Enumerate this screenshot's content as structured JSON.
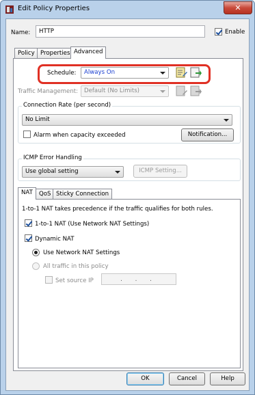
{
  "window": {
    "title": "Edit Policy Properties",
    "close_glyph": "✕"
  },
  "name_row": {
    "label": "Name:",
    "value": "HTTP",
    "enable_label": "Enable",
    "enable_checked": true
  },
  "tabs": [
    {
      "label": "Policy"
    },
    {
      "label": "Properties"
    },
    {
      "label": "Advanced",
      "active": true
    }
  ],
  "advanced": {
    "schedule": {
      "label": "Schedule:",
      "value": "Always On"
    },
    "traffic_management": {
      "label": "Traffic Management:",
      "value": "Default (No Limits)"
    },
    "connection_rate": {
      "title": "Connection Rate (per second)",
      "value": "No Limit",
      "alarm_label": "Alarm when capacity exceeded",
      "alarm_checked": false,
      "notification_button": "Notification..."
    },
    "icmp": {
      "title": "ICMP Error Handling",
      "value": "Use global setting",
      "settings_button": "ICMP Setting..."
    }
  },
  "subtabs": [
    {
      "label": "NAT",
      "active": true
    },
    {
      "label": "QoS"
    },
    {
      "label": "Sticky Connection"
    }
  ],
  "nat": {
    "info": "1-to-1 NAT takes precedence if the traffic qualifies for both rules.",
    "one_to_one_label": "1-to-1 NAT (Use Network NAT Settings)",
    "one_to_one_checked": true,
    "dynamic_label": "Dynamic NAT",
    "dynamic_checked": true,
    "use_network_label": "Use Network NAT Settings",
    "all_traffic_label": "All traffic in this policy",
    "set_source_label": "Set source IP",
    "ip_value": ". . ."
  },
  "footer": {
    "ok": "OK",
    "cancel": "Cancel",
    "help": "Help"
  },
  "colors": {
    "highlight": "#e03024",
    "schedule_text": "#1a3fd0",
    "frame": "#b9d1ea"
  },
  "icons": [
    "app-policy-icon",
    "edit-schedule-icon",
    "add-schedule-icon",
    "edit-traffic-icon",
    "add-traffic-icon"
  ]
}
